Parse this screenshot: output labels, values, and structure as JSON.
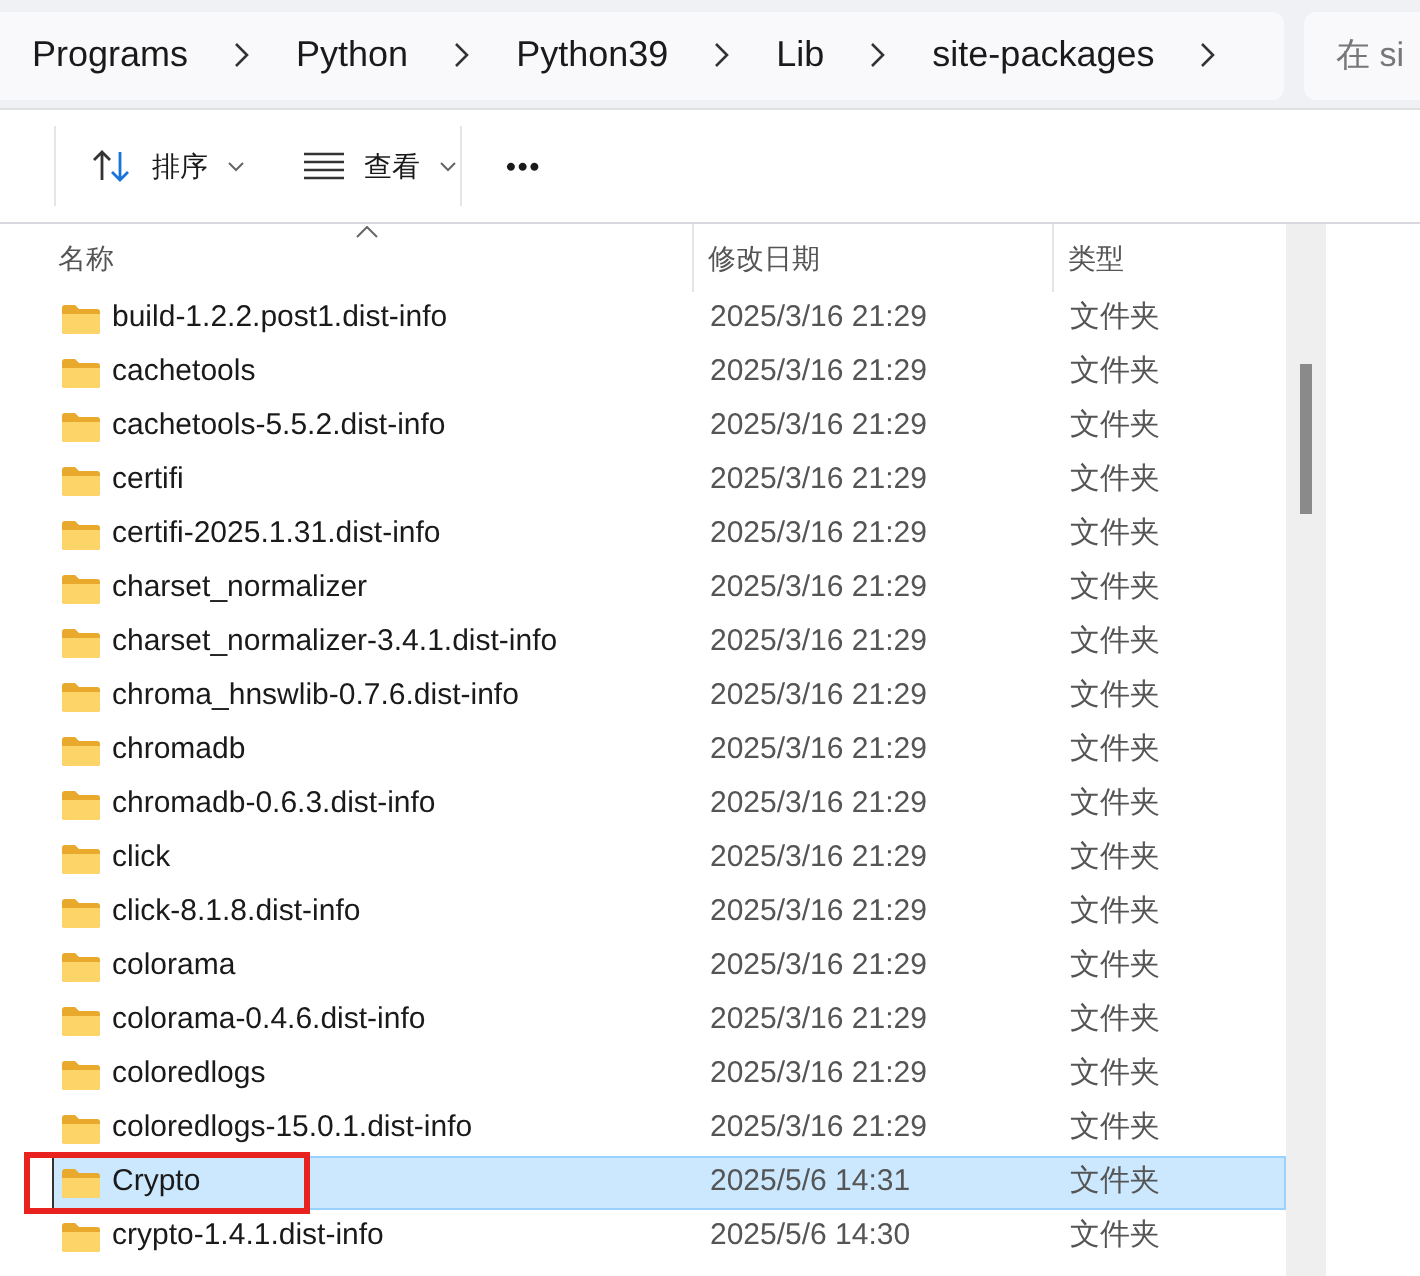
{
  "breadcrumb": [
    "Programs",
    "Python",
    "Python39",
    "Lib",
    "site-packages"
  ],
  "search": {
    "placeholder": "在 si"
  },
  "toolbar": [
    {
      "kind": "sort",
      "label": "排序"
    },
    {
      "kind": "view",
      "label": "查看"
    },
    {
      "kind": "more",
      "label": "•••"
    }
  ],
  "columns": [
    "名称",
    "修改日期",
    "类型"
  ],
  "rows": [
    {
      "name": "build-1.2.2.post1.dist-info",
      "date": "2025/3/16 21:29",
      "type": "文件夹",
      "selected": false
    },
    {
      "name": "cachetools",
      "date": "2025/3/16 21:29",
      "type": "文件夹",
      "selected": false
    },
    {
      "name": "cachetools-5.5.2.dist-info",
      "date": "2025/3/16 21:29",
      "type": "文件夹",
      "selected": false
    },
    {
      "name": "certifi",
      "date": "2025/3/16 21:29",
      "type": "文件夹",
      "selected": false
    },
    {
      "name": "certifi-2025.1.31.dist-info",
      "date": "2025/3/16 21:29",
      "type": "文件夹",
      "selected": false
    },
    {
      "name": "charset_normalizer",
      "date": "2025/3/16 21:29",
      "type": "文件夹",
      "selected": false
    },
    {
      "name": "charset_normalizer-3.4.1.dist-info",
      "date": "2025/3/16 21:29",
      "type": "文件夹",
      "selected": false
    },
    {
      "name": "chroma_hnswlib-0.7.6.dist-info",
      "date": "2025/3/16 21:29",
      "type": "文件夹",
      "selected": false
    },
    {
      "name": "chromadb",
      "date": "2025/3/16 21:29",
      "type": "文件夹",
      "selected": false
    },
    {
      "name": "chromadb-0.6.3.dist-info",
      "date": "2025/3/16 21:29",
      "type": "文件夹",
      "selected": false
    },
    {
      "name": "click",
      "date": "2025/3/16 21:29",
      "type": "文件夹",
      "selected": false
    },
    {
      "name": "click-8.1.8.dist-info",
      "date": "2025/3/16 21:29",
      "type": "文件夹",
      "selected": false
    },
    {
      "name": "colorama",
      "date": "2025/3/16 21:29",
      "type": "文件夹",
      "selected": false
    },
    {
      "name": "colorama-0.4.6.dist-info",
      "date": "2025/3/16 21:29",
      "type": "文件夹",
      "selected": false
    },
    {
      "name": "coloredlogs",
      "date": "2025/3/16 21:29",
      "type": "文件夹",
      "selected": false
    },
    {
      "name": "coloredlogs-15.0.1.dist-info",
      "date": "2025/3/16 21:29",
      "type": "文件夹",
      "selected": false
    },
    {
      "name": "Crypto",
      "date": "2025/5/6 14:31",
      "type": "文件夹",
      "selected": true
    },
    {
      "name": "crypto-1.4.1.dist-info",
      "date": "2025/5/6 14:30",
      "type": "文件夹",
      "selected": false
    }
  ]
}
